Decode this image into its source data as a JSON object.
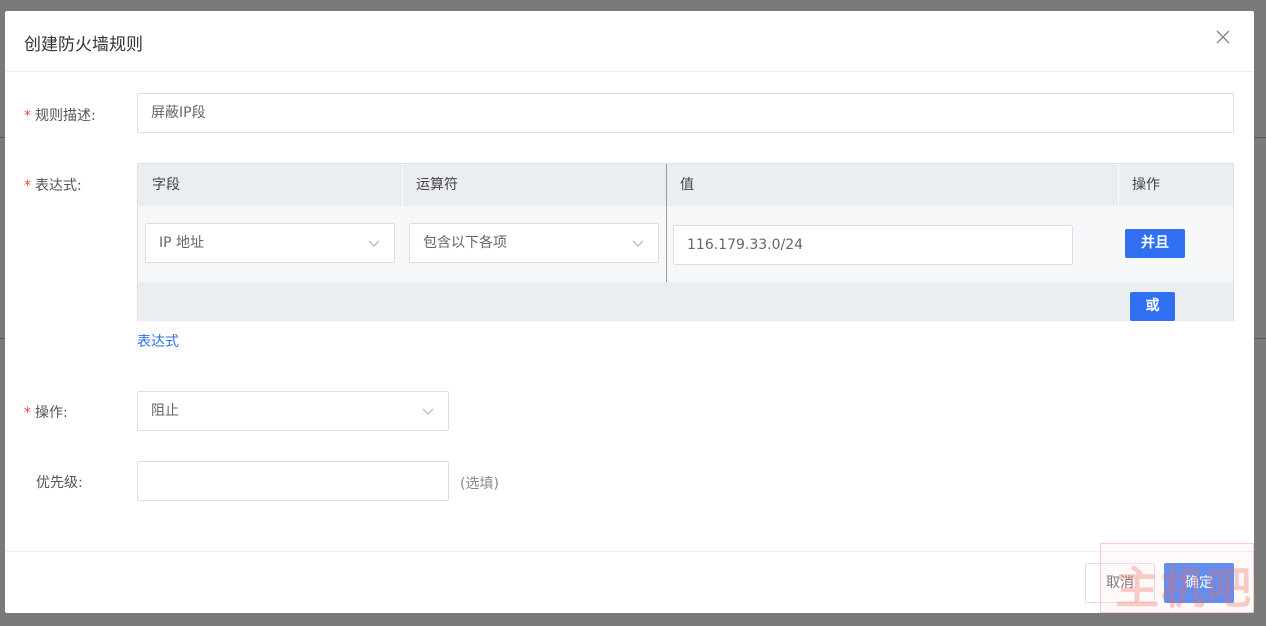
{
  "dialog": {
    "title": "创建防火墙规则",
    "close_icon": "close-icon"
  },
  "form": {
    "description": {
      "label": "规则描述:",
      "value": "屏蔽IP段"
    },
    "expression": {
      "label": "表达式:",
      "columns": [
        "字段",
        "运算符",
        "值",
        "操作"
      ],
      "rows": [
        {
          "field": "IP 地址",
          "operator": "包含以下各项",
          "value": "116.179.33.0/24",
          "and_button": "并且"
        }
      ],
      "or_button": "或",
      "add_link": "表达式"
    },
    "action": {
      "label": "操作:",
      "value": "阻止"
    },
    "priority": {
      "label": "优先级:",
      "value": "",
      "hint": "(选填)"
    },
    "required_mark": "*"
  },
  "footer": {
    "cancel_label": "取消",
    "confirm_label": "确定"
  },
  "colors": {
    "primary": "#2f6ff0",
    "required": "#e74c3c",
    "overlay": "#7a7a7a"
  },
  "watermark": {
    "text": "主机吧"
  }
}
